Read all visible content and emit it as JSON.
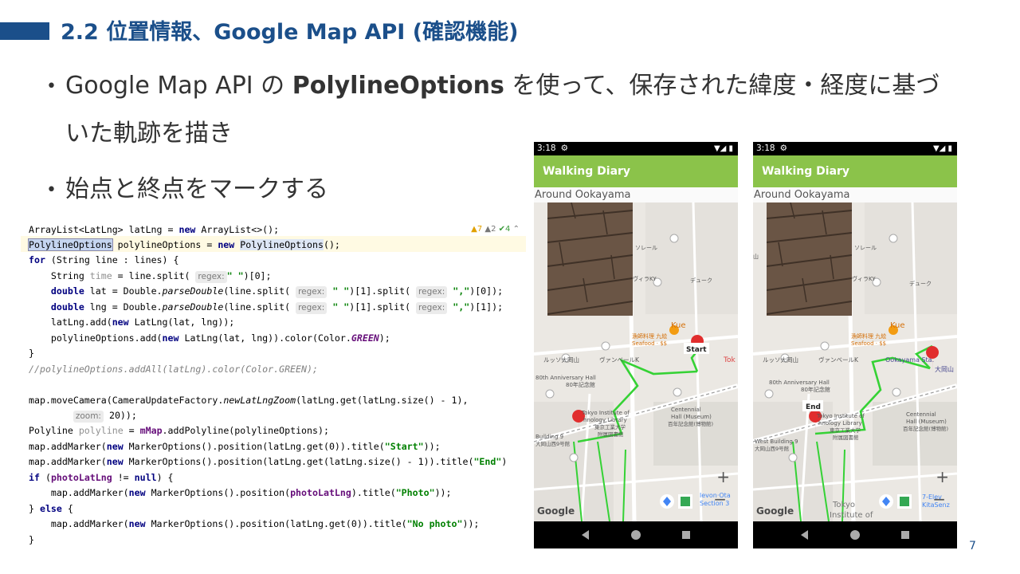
{
  "header": {
    "title": "2.2 位置情報、Google Map API (確認機能)"
  },
  "bullets": {
    "b1_prefix": "Google Map API の ",
    "b1_bold": "PolylineOptions",
    "b1_suffix": " を使って、保存された緯度・経度に基づ",
    "b1_cont": "いた軌跡を描き",
    "b2": "始点と終点をマークする",
    "marker": "•"
  },
  "code": {
    "inspection": {
      "warnings": "▲7",
      "weak": "▲2",
      "ok": "✔4",
      "arrow": "⌃"
    },
    "hints": {
      "regex": "regex:",
      "zoom": "zoom:"
    }
  },
  "phone": {
    "time": "3:18",
    "status_icons": "▼◢ ▮",
    "app_title": "Walking Diary",
    "place": "Around Ookayama",
    "zoom_plus": "+",
    "zoom_minus": "−",
    "google": "Google",
    "start_label": "Start",
    "end_label": "End",
    "map_labels": {
      "kue": "Kue",
      "kue_sub": "漁師料理 九絵",
      "kue_price": "Seafood · $$",
      "rousseau": "ルッソ大岡山",
      "vanbell": "ヴァンベールK",
      "anniv": "80th Anniversary Hall",
      "anniv_ja": "80年記念館",
      "centennial": "Centennial",
      "centennial2": "Hall (Museum)",
      "centennial_ja": "百年記念館(博物館)",
      "library": "Tokyo Institute of",
      "library2": "hnology Library",
      "library_ja": "東京工業大学",
      "library_ja2": "附属図書館",
      "bldg9": "Building 9",
      "bldg9_ja": "大岡山西9号館",
      "west_bldg9": "West Building 9",
      "duke": "デューク",
      "sorel": "ソレール",
      "villa": "ヴィラKY",
      "ookayama_sta": "Ookayama Sta.",
      "ookayama_ja": "大岡山",
      "tokyo_inst": "Tokyo",
      "tokyo_inst2": "Institute of",
      "tok": "Tok",
      "san": "山"
    }
  },
  "slide_number": "7"
}
